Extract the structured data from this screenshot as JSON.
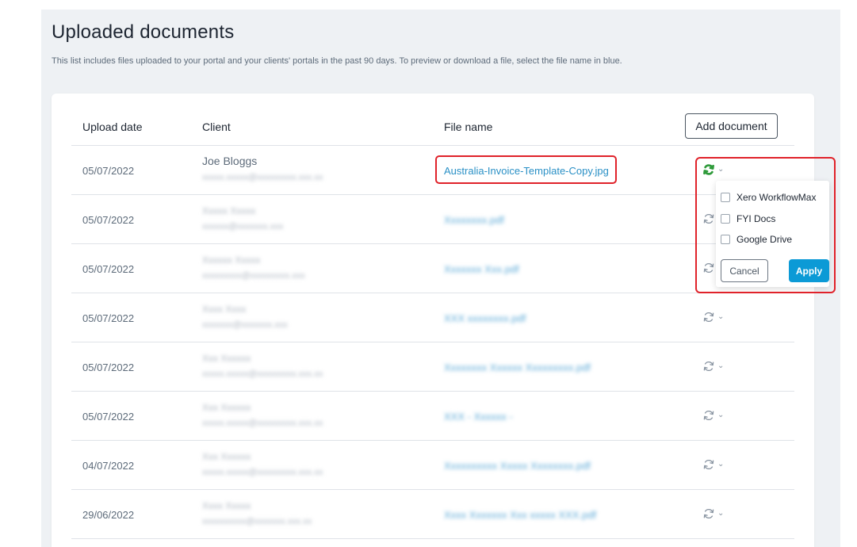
{
  "page": {
    "title": "Uploaded documents",
    "subtitle": "This list includes files uploaded to your portal and your clients' portals in the past 90 days. To preview or download a file, select the file name in blue."
  },
  "table": {
    "headers": {
      "date": "Upload date",
      "client": "Client",
      "file": "File name"
    },
    "add_document_label": "Add document",
    "rows": [
      {
        "date": "05/07/2022",
        "client": "Joe Bloggs",
        "email": "xxxxx.xxxxx@xxxxxxxxx.xxx.xx",
        "file": "Australia-Invoice-Template-Copy.jpg",
        "sync_state": "active"
      },
      {
        "date": "05/07/2022",
        "client": "Xxxxx Xxxxx",
        "email": "xxxxxx@xxxxxxx.xxx",
        "file": "Xxxxxxxx.pdf",
        "sync_state": "idle"
      },
      {
        "date": "05/07/2022",
        "client": "Xxxxxx Xxxxx",
        "email": "xxxxxxxxx@xxxxxxxxx.xxx",
        "file": "Xxxxxxx Xxx.pdf",
        "sync_state": "idle"
      },
      {
        "date": "05/07/2022",
        "client": "Xxxx Xxxx",
        "email": "xxxxxxx@xxxxxxx.xxx",
        "file": "XXX xxxxxxxx.pdf",
        "sync_state": "idle"
      },
      {
        "date": "05/07/2022",
        "client": "Xxx Xxxxxx",
        "email": "xxxxx.xxxxx@xxxxxxxxx.xxx.xx",
        "file": "Xxxxxxxx Xxxxxx Xxxxxxxxx.pdf",
        "sync_state": "idle"
      },
      {
        "date": "05/07/2022",
        "client": "Xxx Xxxxxx",
        "email": "xxxxx.xxxxx@xxxxxxxxx.xxx.xx",
        "file": "XXX - Xxxxxx -",
        "sync_state": "idle"
      },
      {
        "date": "04/07/2022",
        "client": "Xxx Xxxxxx",
        "email": "xxxxx.xxxxx@xxxxxxxxx.xxx.xx",
        "file": "Xxxxxxxxxx Xxxxx Xxxxxxxx.pdf",
        "sync_state": "idle"
      },
      {
        "date": "29/06/2022",
        "client": "Xxxx Xxxxx",
        "email": "xxxxxxxxxx@xxxxxxx.xxx.xx",
        "file": "Xxxx Xxxxxxx Xxx xxxxx XXX.pdf",
        "sync_state": "idle"
      }
    ]
  },
  "sync_menu": {
    "options": [
      "Xero WorkflowMax",
      "FYI Docs",
      "Google Drive"
    ],
    "cancel_label": "Cancel",
    "apply_label": "Apply"
  },
  "colors": {
    "link": "#2a90c6",
    "apply": "#0c9ad6",
    "highlight": "#e0222a",
    "sync_active": "#2e9a3a",
    "sync_idle": "#8a95a2"
  },
  "icons": {
    "sync": "sync-icon",
    "chevron": "chevron-down-icon"
  }
}
